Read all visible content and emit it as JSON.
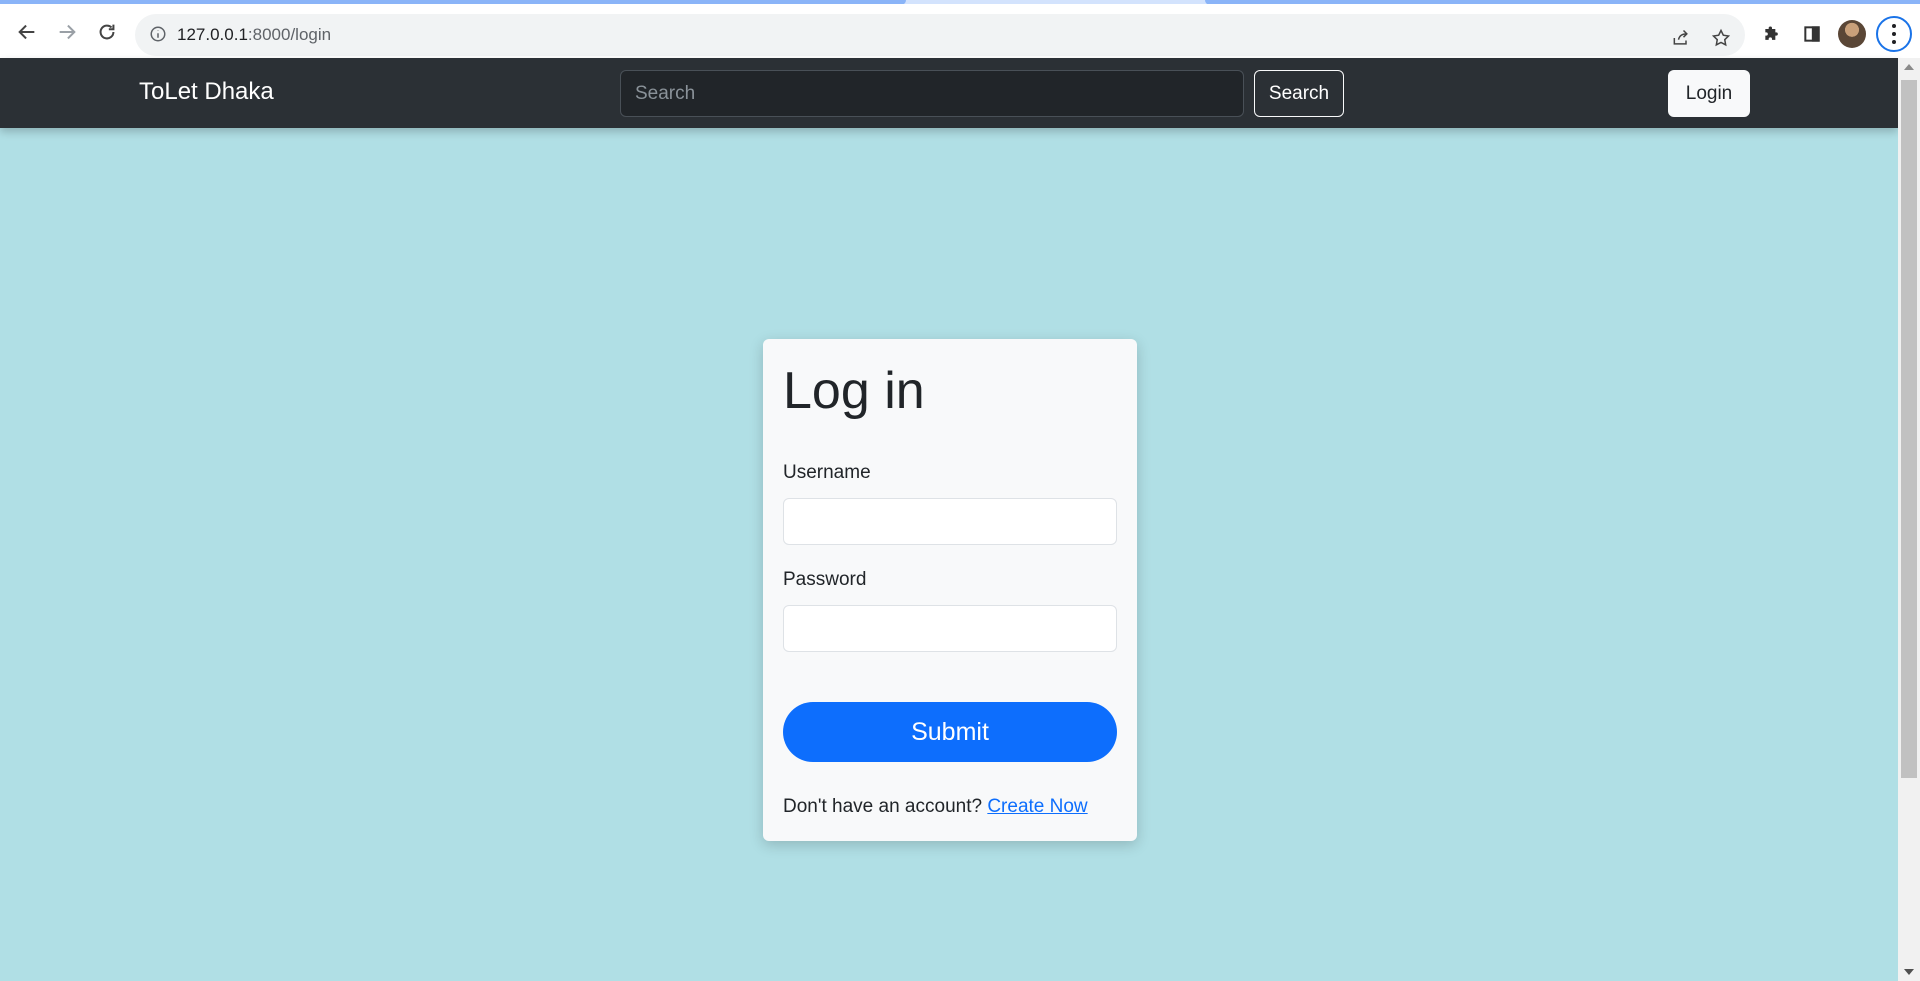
{
  "browser": {
    "url_host": "127.0.0.1",
    "url_path": ":8000/login",
    "back_icon": "arrow-left-icon",
    "forward_icon": "arrow-right-icon",
    "reload_icon": "reload-icon"
  },
  "navbar": {
    "brand": "ToLet Dhaka",
    "search_placeholder": "Search",
    "search_button": "Search",
    "login_button": "Login"
  },
  "login_card": {
    "title": "Log in",
    "username_label": "Username",
    "username_value": "",
    "password_label": "Password",
    "password_value": "",
    "submit_label": "Submit",
    "signup_prompt": "Don't have an account?",
    "signup_link": "Create Now"
  },
  "colors": {
    "page_background": "#b0dfe5",
    "navbar_background": "#2b3035",
    "primary": "#0d6efd",
    "card_background": "#f8f9fa"
  }
}
